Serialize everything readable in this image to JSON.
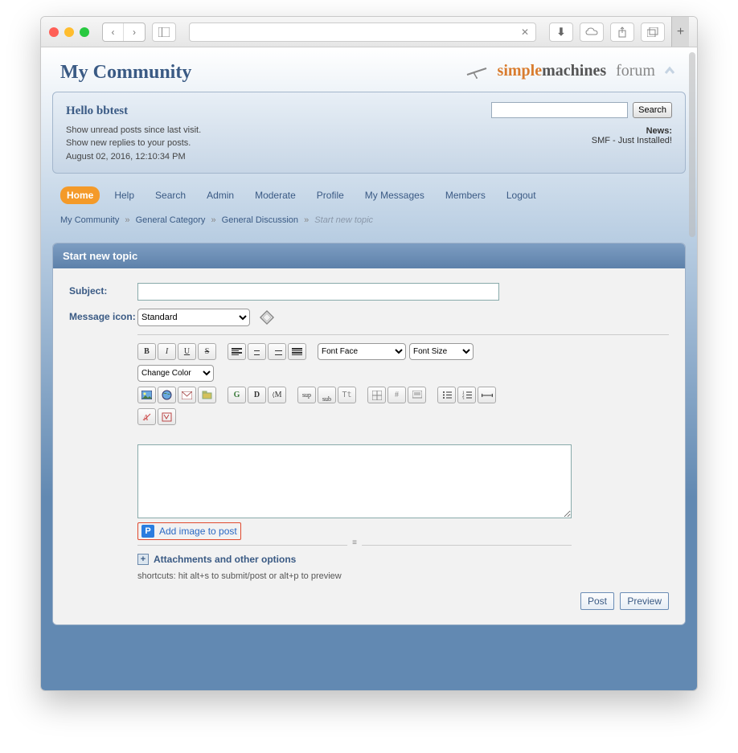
{
  "site": {
    "title": "My Community"
  },
  "logo": {
    "simple": "simple",
    "machines": "machines",
    "forum": "forum"
  },
  "user_panel": {
    "greeting": "Hello bbtest",
    "unread_link": "Show unread posts since last visit.",
    "replies_link": "Show new replies to your posts.",
    "datetime": "August 02, 2016, 12:10:34 PM"
  },
  "news": {
    "label": "News:",
    "text": "SMF - Just Installed!"
  },
  "search": {
    "button": "Search",
    "value": ""
  },
  "menu": {
    "home": "Home",
    "help": "Help",
    "search": "Search",
    "admin": "Admin",
    "moderate": "Moderate",
    "profile": "Profile",
    "messages": "My Messages",
    "members": "Members",
    "logout": "Logout"
  },
  "breadcrumb": {
    "community": "My Community",
    "category": "General Category",
    "board": "General Discussion",
    "current": "Start new topic"
  },
  "panel": {
    "title": "Start new topic"
  },
  "form": {
    "subject_label": "Subject:",
    "subject_value": "",
    "icon_label": "Message icon:",
    "icon_selected": "Standard",
    "font_face": "Font Face",
    "font_size": "Font Size",
    "change_color": "Change Color",
    "message_value": ""
  },
  "bbc": {
    "bold": "B",
    "italic": "I",
    "underline": "U",
    "strike": "S",
    "glow": "G",
    "shadow": "D",
    "marquee": "M",
    "sup": "sup",
    "sub": "sub",
    "tt": "Tt",
    "hash": "#"
  },
  "add_image": {
    "p": "P",
    "label": "Add image to post"
  },
  "attachments": {
    "label": "Attachments and other options"
  },
  "shortcuts": "shortcuts: hit alt+s to submit/post or alt+p to preview",
  "buttons": {
    "post": "Post",
    "preview": "Preview"
  }
}
